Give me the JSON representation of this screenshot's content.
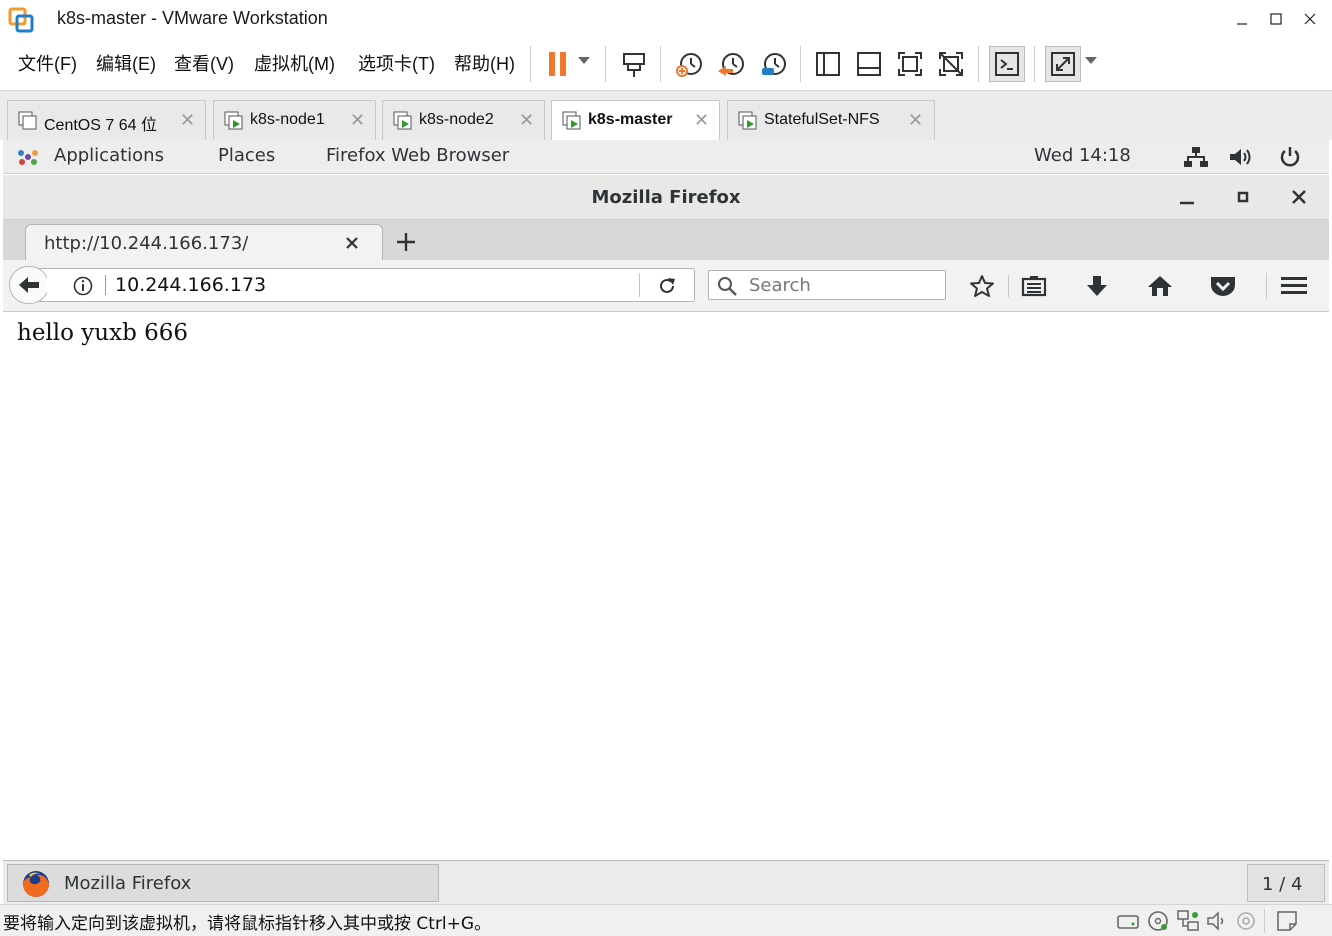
{
  "vmware": {
    "window_title": "k8s-master - VMware Workstation",
    "menu": [
      "文件(F)",
      "编辑(E)",
      "查看(V)",
      "虚拟机(M)",
      "选项卡(T)",
      "帮助(H)"
    ],
    "tabs": [
      {
        "label": "CentOS 7 64 位"
      },
      {
        "label": "k8s-node1"
      },
      {
        "label": "k8s-node2"
      },
      {
        "label": "k8s-master",
        "active": true
      },
      {
        "label": "StatefulSet-NFS"
      }
    ],
    "status_message": "要将输入定向到该虚拟机，请将鼠标指针移入其中或按 Ctrl+G。",
    "accent_color": "#f0782d"
  },
  "gnome": {
    "applications": "Applications",
    "places": "Places",
    "active_app": "Firefox Web Browser",
    "clock": "Wed 14:18"
  },
  "firefox": {
    "window_title": "Mozilla Firefox",
    "tab_title": "http://10.244.166.173/",
    "url": "10.244.166.173",
    "search_placeholder": "Search",
    "page_text": "hello yuxb 666"
  },
  "taskbar": {
    "item_label": "Mozilla Firefox",
    "workspace": "1 / 4"
  }
}
